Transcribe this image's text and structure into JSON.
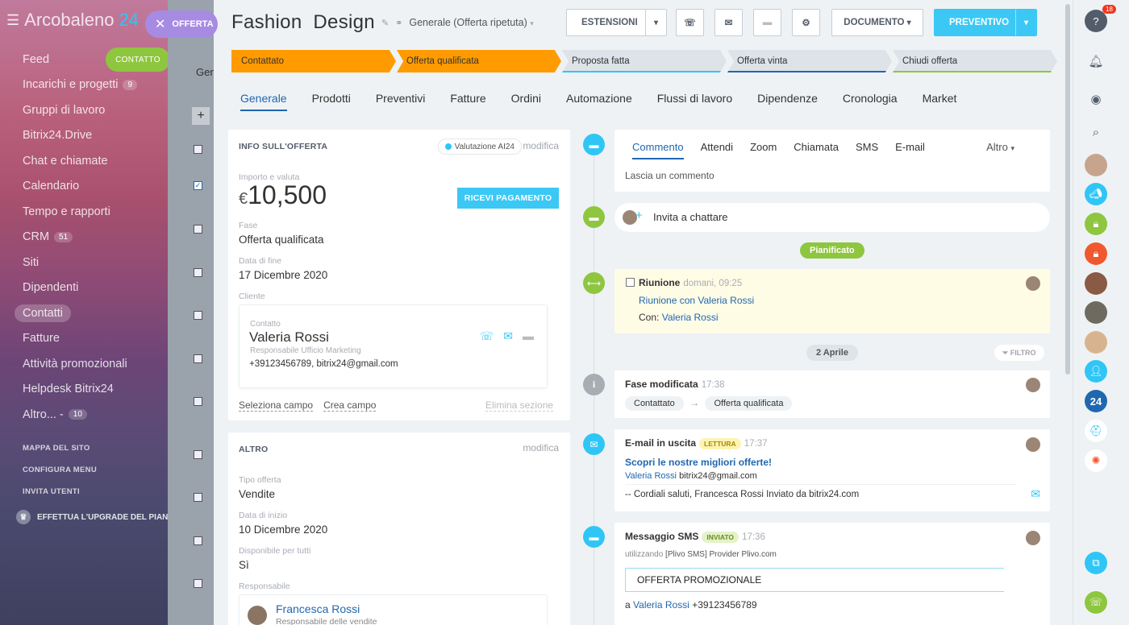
{
  "nav": {
    "brand_main": "Arcobaleno",
    "brand_num": "24",
    "close_pill": "OFFERTA",
    "contatto_pill": "CONTATTO",
    "items": [
      {
        "label": "Feed",
        "count": ""
      },
      {
        "label": "Incarichi e progetti",
        "count": "9"
      },
      {
        "label": "Gruppi di lavoro",
        "count": ""
      },
      {
        "label": "Bitrix24.Drive",
        "count": ""
      },
      {
        "label": "Chat e chiamate",
        "count": ""
      },
      {
        "label": "Calendario",
        "count": ""
      },
      {
        "label": "Tempo e rapporti",
        "count": ""
      },
      {
        "label": "CRM",
        "count": "51"
      },
      {
        "label": "Siti",
        "count": ""
      },
      {
        "label": "Dipendenti",
        "count": ""
      },
      {
        "label": "Contatti",
        "count": ""
      },
      {
        "label": "Fatture",
        "count": ""
      },
      {
        "label": "Attività promozionali",
        "count": ""
      },
      {
        "label": "Helpdesk Bitrix24",
        "count": ""
      },
      {
        "label": "Altro... -",
        "count": "10"
      }
    ],
    "small_links": [
      "MAPPA DEL SITO",
      "CONFIGURA MENU",
      "INVITA UTENTI"
    ],
    "upgrade": "EFFETTUA L'UPGRADE DEL PIANO"
  },
  "bglist": {
    "tab_partial": "Gen"
  },
  "header": {
    "title_a": "Fashion",
    "title_b": "Design",
    "pipeline": "Generale (Offerta ripetuta)",
    "btn_estensioni": "ESTENSIONI",
    "btn_documento": "DOCUMENTO",
    "btn_preventivo": "PREVENTIVO"
  },
  "stages": [
    {
      "label": "Contattato",
      "state": "done",
      "color": "#ff9b00"
    },
    {
      "label": "Offerta qualificata",
      "state": "done",
      "color": "#ff9b00"
    },
    {
      "label": "Proposta fatta",
      "state": "todo",
      "color": "#2fc6f6"
    },
    {
      "label": "Offerta vinta",
      "state": "todo",
      "color": "#2067b0"
    },
    {
      "label": "Chiudi offerta",
      "state": "todo",
      "color": "#8ec63f"
    }
  ],
  "tabs": [
    "Generale",
    "Prodotti",
    "Preventivi",
    "Fatture",
    "Ordini",
    "Automazione",
    "Flussi di lavoro",
    "Dipendenze",
    "Cronologia",
    "Market"
  ],
  "info_card": {
    "header": "INFO SULL'OFFERTA",
    "ai_badge": "Valutazione AI24",
    "edit": "modifica",
    "amount_label": "Importo e valuta",
    "currency": "€",
    "amount": "10,500",
    "pay_button": "RICEVI PAGAMENTO",
    "stage_label": "Fase",
    "stage_value": "Offerta qualificata",
    "end_label": "Data di fine",
    "end_value": "17 Dicembre 2020",
    "client_label": "Cliente",
    "client": {
      "type": "Contatto",
      "name": "Valeria Rossi",
      "role": "Responsabile Ufficio Marketing",
      "contact": "+39123456789, bitrix24@gmail.com"
    },
    "footer_select": "Seleziona campo",
    "footer_create": "Crea campo",
    "footer_delete": "Elimina sezione"
  },
  "other_card": {
    "header": "ALTRO",
    "edit": "modifica",
    "type_label": "Tipo offerta",
    "type_value": "Vendite",
    "start_label": "Data di inizio",
    "start_value": "10 Dicembre 2020",
    "avail_label": "Disponibile per tutti",
    "avail_value": "Sì",
    "resp_label": "Responsabile",
    "resp_name": "Francesca Rossi",
    "resp_role": "Responsabile delle vendite"
  },
  "timeline": {
    "tabs": [
      "Commento",
      "Attendi",
      "Zoom",
      "Chiamata",
      "SMS",
      "E-mail"
    ],
    "altro": "Altro",
    "comment_placeholder": "Lascia un commento",
    "invite": "Invita a chattare",
    "planned": "Pianificato",
    "meeting": {
      "title": "Riunione",
      "time": "domani, 09:25",
      "link": "Riunione con Valeria Rossi",
      "with_label": "Con:",
      "with_name": "Valeria Rossi"
    },
    "date_sep": "2 Aprile",
    "filter": "FILTRO",
    "stage_change": {
      "title": "Fase modificata",
      "time": "17:38",
      "from": "Contattato",
      "to": "Offerta qualificata"
    },
    "email": {
      "title": "E-mail in uscita",
      "tag": "LETTURA",
      "time": "17:37",
      "subject": "Scopri le nostre migliori offerte!",
      "to_name": "Valeria Rossi",
      "to_mail": "bitrix24@gmail.com",
      "body": "-- Cordiali saluti, Francesca Rossi Inviato da bitrix24.com"
    },
    "sms": {
      "title": "Messaggio SMS",
      "tag": "INVIATO",
      "time": "17:36",
      "via_pre": "utilizzando",
      "via_provider": "[Plivo SMS]",
      "via_post": "Provider Plivo.com",
      "message": "OFFERTA PROMOZIONALE",
      "to_pre": "a",
      "to_name": "Valeria Rossi",
      "to_phone": "+39123456789"
    }
  },
  "rightbar": {
    "notif_count": "18",
    "badge24": "24"
  }
}
